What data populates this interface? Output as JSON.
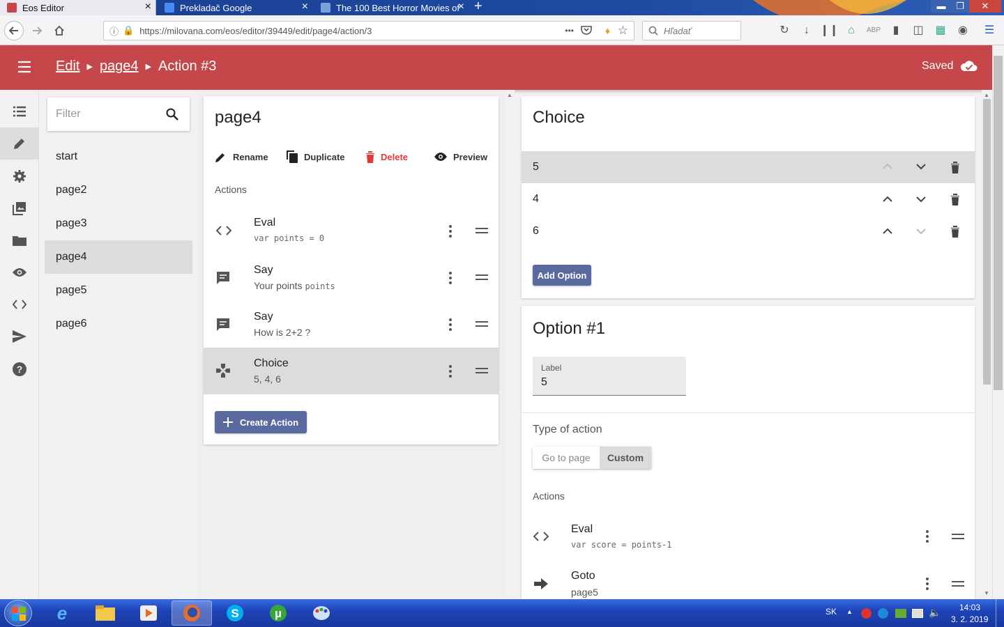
{
  "browser": {
    "tabs": [
      {
        "title": "Eos Editor",
        "close": "×"
      },
      {
        "title": "Prekladač Google",
        "close": "×"
      },
      {
        "title": "The 100 Best Horror Movies of",
        "close": "×"
      }
    ],
    "new_tab": "+",
    "url": "https://milovana.com/eos/editor/39449/edit/page4/action/3",
    "url_domain": "milovana.com",
    "search_placeholder": "Hľadať",
    "url_more": "•••"
  },
  "header": {
    "crumb1": "Edit",
    "crumb2": "page4",
    "crumb3": "Action #3",
    "saved": "Saved"
  },
  "sidebar": {
    "filter_placeholder": "Filter",
    "pages": [
      "start",
      "page2",
      "page3",
      "page4",
      "page5",
      "page6"
    ],
    "selected": "page4"
  },
  "page": {
    "title": "page4",
    "rename": "Rename",
    "duplicate": "Duplicate",
    "delete": "Delete",
    "preview": "Preview",
    "actions_heading": "Actions",
    "actions": [
      {
        "title": "Eval",
        "sub": "var points = 0",
        "icon": "code-icon"
      },
      {
        "title": "Say",
        "sub_text": "Your points ",
        "sub_code": "points",
        "icon": "message-icon"
      },
      {
        "title": "Say",
        "sub": "How is 2+2 ?",
        "icon": "message-icon"
      },
      {
        "title": "Choice",
        "sub": "5, 4, 6",
        "icon": "gamepad-icon"
      }
    ],
    "create_action": "Create Action"
  },
  "choice": {
    "title": "Choice",
    "options": [
      "5",
      "4",
      "6"
    ],
    "add_option": "Add Option"
  },
  "option": {
    "title": "Option #1",
    "label_caption": "Label",
    "label_value": "5",
    "type_heading": "Type of action",
    "type_options": [
      "Go to page",
      "Custom"
    ],
    "type_selected": "Custom",
    "actions_heading": "Actions",
    "actions": [
      {
        "title": "Eval",
        "sub": "var score = points-1"
      },
      {
        "title": "Goto",
        "sub": "page5"
      }
    ]
  },
  "taskbar": {
    "lang": "SK",
    "time": "14:03",
    "date": "3. 2. 2019"
  },
  "colors": {
    "header": "#c5474a",
    "button": "#5a6a9e",
    "delete": "#e53935"
  }
}
